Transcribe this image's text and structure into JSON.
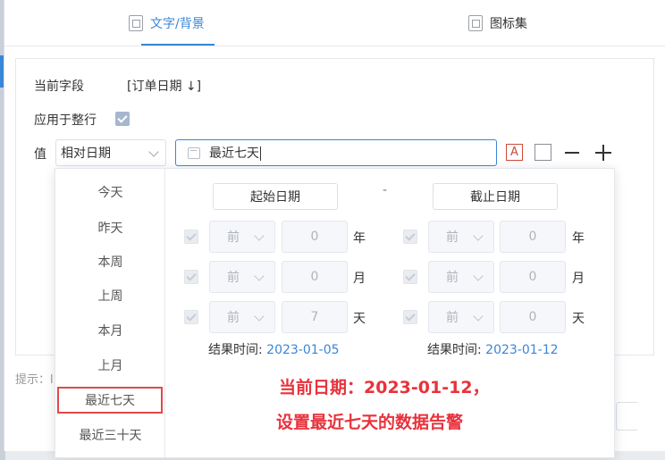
{
  "tabs": [
    {
      "label": "文字/背景",
      "active": true
    },
    {
      "label": "图标集",
      "active": false
    }
  ],
  "form": {
    "current_field_label": "当前字段",
    "current_field_value": "[订单日期 ↓]",
    "apply_row_label": "应用于整行",
    "apply_row_checked": true,
    "value_label": "值",
    "value_type": "相对日期",
    "date_range_value": "最近七天",
    "font_color_icon_letter": "A"
  },
  "hint": "提示：l",
  "shortcuts": [
    {
      "label": "今天"
    },
    {
      "label": "昨天"
    },
    {
      "label": "本周"
    },
    {
      "label": "上周"
    },
    {
      "label": "本月"
    },
    {
      "label": "上月"
    },
    {
      "label": "最近七天",
      "selected": true
    },
    {
      "label": "最近三十天"
    }
  ],
  "range": {
    "start_label": "起始日期",
    "end_label": "截止日期",
    "separator": "-",
    "start": {
      "rows": [
        {
          "direction": "前",
          "value": "0",
          "unit": "年"
        },
        {
          "direction": "前",
          "value": "0",
          "unit": "月"
        },
        {
          "direction": "前",
          "value": "7",
          "unit": "天"
        }
      ],
      "result_label": "结果时间:",
      "result_date": "2023-01-05"
    },
    "end": {
      "rows": [
        {
          "direction": "前",
          "value": "0",
          "unit": "年"
        },
        {
          "direction": "前",
          "value": "0",
          "unit": "月"
        },
        {
          "direction": "前",
          "value": "0",
          "unit": "天"
        }
      ],
      "result_label": "结果时间:",
      "result_date": "2023-01-12"
    }
  },
  "annotation": {
    "line1": "当前日期：2023-01-12，",
    "line2": "设置最近七天的数据告警",
    "color": "#e8323c"
  },
  "colors": {
    "accent": "#3a86d8",
    "highlight_border": "#e04a4a"
  }
}
